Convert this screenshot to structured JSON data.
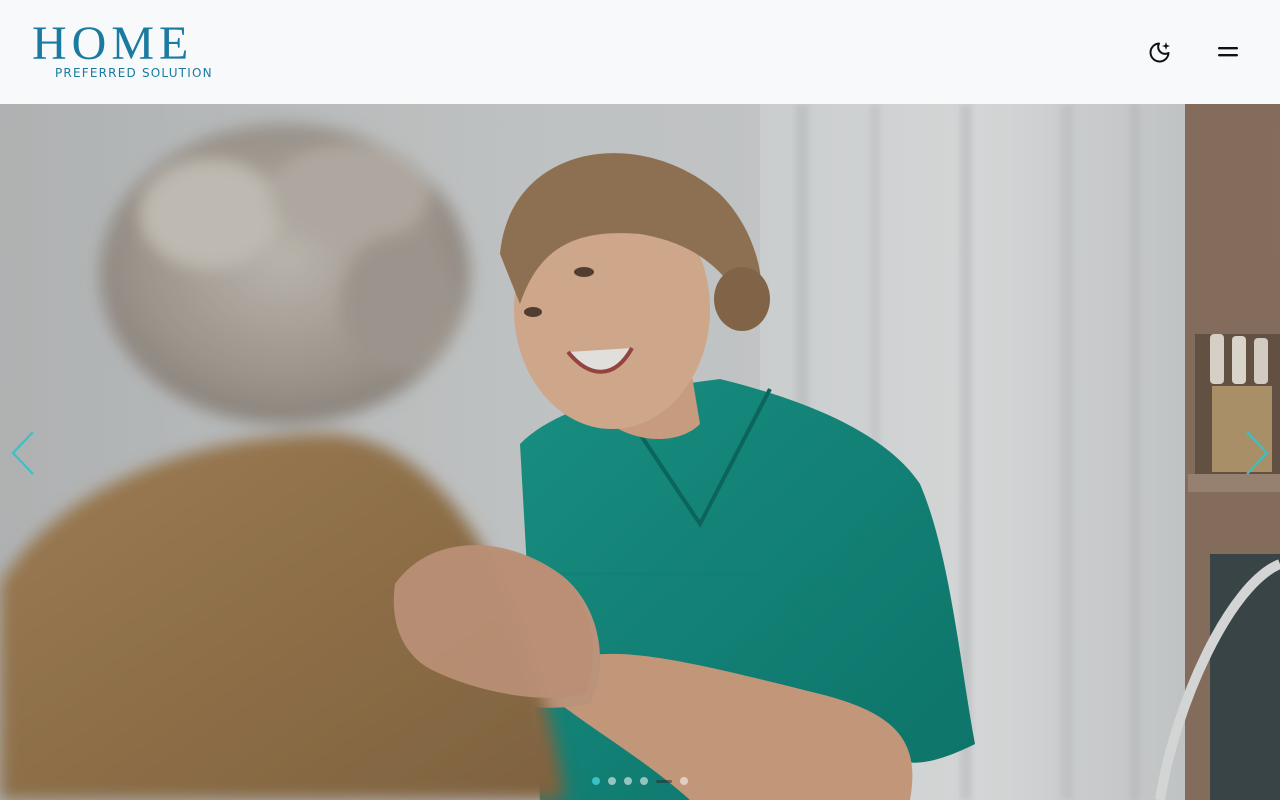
{
  "brand": {
    "name": "HOME",
    "tagline": "PREFERRED SOLUTION",
    "color": "#1a7aa0"
  },
  "header": {
    "theme_toggle_icon": "moon-sparkle-icon",
    "menu_icon": "hamburger-menu-icon"
  },
  "carousel": {
    "accent_color": "#39c1c5",
    "prev_icon": "chevron-left-icon",
    "next_icon": "chevron-right-icon",
    "slide_count": 6,
    "active_slide": 1
  }
}
